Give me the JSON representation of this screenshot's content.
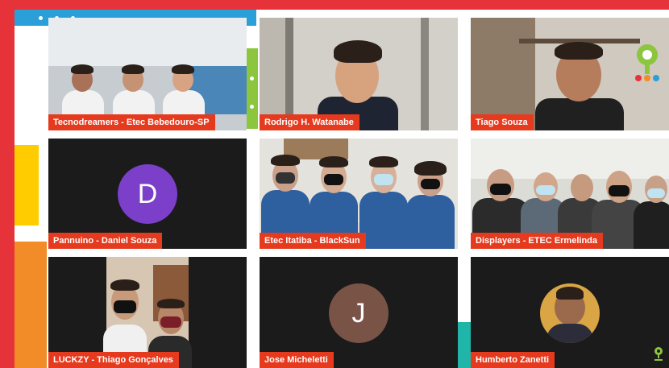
{
  "participants": [
    {
      "name": "Tecnodreamers - Etec Bebedouro-SP"
    },
    {
      "name": "Rodrigo H. Watanabe"
    },
    {
      "name": "Tiago Souza"
    },
    {
      "name": "Pannuino - Daniel Souza",
      "avatar_letter": "D",
      "avatar_color": "#7b3fc9"
    },
    {
      "name": "Etec Itatiba - BlackSun"
    },
    {
      "name": "Displayers - ETEC Ermelinda"
    },
    {
      "name": "LUCKZY - Thiago Gonçalves"
    },
    {
      "name": "Jose Micheletti",
      "avatar_letter": "J",
      "avatar_color": "#7a5347"
    },
    {
      "name": "Humberto Zanetti"
    }
  ],
  "colors": {
    "background_red": "#e6333a",
    "label_bg": "#e53a1e",
    "tile_dark": "#1b1b1b"
  }
}
